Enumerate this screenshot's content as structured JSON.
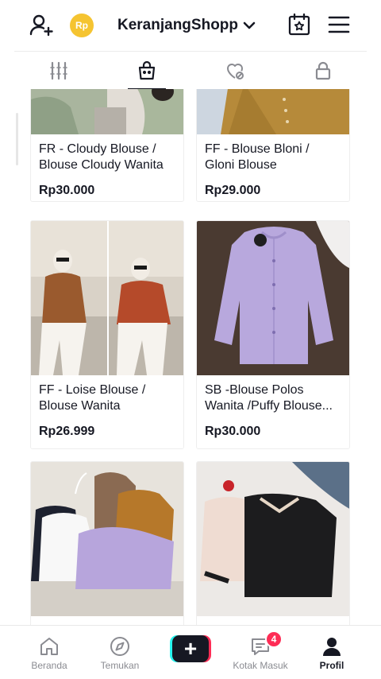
{
  "header": {
    "coin_label": "Rp",
    "account_name": "KeranjangShopp",
    "icons": [
      "add-user-icon",
      "coin-icon",
      "chevron-down-icon",
      "calendar-icon",
      "menu-icon"
    ]
  },
  "tabs": [
    {
      "icon": "grid-icon",
      "active": false
    },
    {
      "icon": "shopping-bag-icon",
      "active": true
    },
    {
      "icon": "liked-hidden-icon",
      "active": false
    },
    {
      "icon": "lock-icon",
      "active": false
    }
  ],
  "products": [
    {
      "title": "FR - Cloudy Blouse / Blouse Cloudy Wanita",
      "price": "Rp30.000"
    },
    {
      "title": "FF - Blouse Bloni / Gloni Blouse",
      "price": "Rp29.000"
    },
    {
      "title": "FF - Loise Blouse / Blouse Wanita",
      "price": "Rp26.999"
    },
    {
      "title": "SB -Blouse Polos Wanita /Puffy Blouse...",
      "price": "Rp30.000"
    },
    {
      "title": "",
      "price": ""
    },
    {
      "title": "",
      "price": ""
    }
  ],
  "bottom_nav": {
    "items": [
      {
        "label": "Beranda",
        "icon": "home-icon",
        "active": false
      },
      {
        "label": "Temukan",
        "icon": "compass-icon",
        "active": false
      },
      {
        "label": "",
        "icon": "plus-icon",
        "active": false
      },
      {
        "label": "Kotak Masuk",
        "icon": "inbox-icon",
        "active": false
      },
      {
        "label": "Profil",
        "icon": "profile-icon",
        "active": true
      }
    ],
    "inbox_badge": "4"
  },
  "colors": {
    "text": "#161823",
    "accent_red": "#fe2c55",
    "accent_cyan": "#25f4ee",
    "coin": "#f5c431",
    "muted": "#8a8b91"
  }
}
